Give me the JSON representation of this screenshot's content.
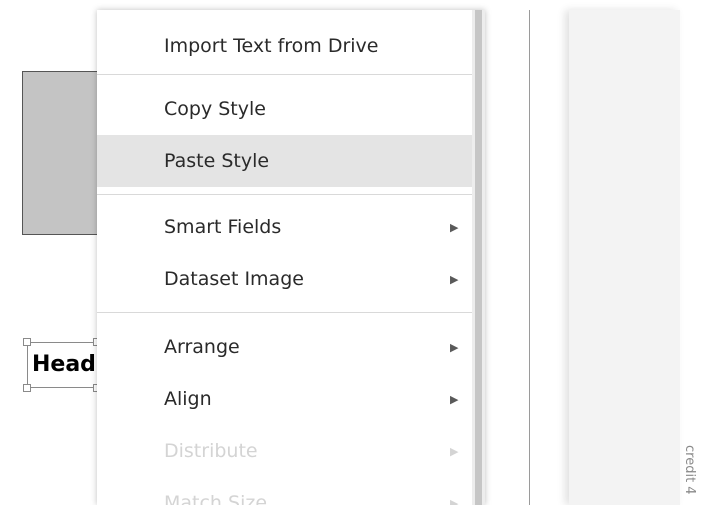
{
  "canvas": {
    "heading_text": "Heading"
  },
  "right_panel": {
    "credit_text": "credit 4"
  },
  "context_menu": {
    "items": [
      {
        "label": "Import Text from Drive",
        "has_submenu": false,
        "enabled": true,
        "highlighted": false
      },
      {
        "label": "Copy Style",
        "has_submenu": false,
        "enabled": true,
        "highlighted": false
      },
      {
        "label": "Paste Style",
        "has_submenu": false,
        "enabled": true,
        "highlighted": true
      },
      {
        "label": "Smart Fields",
        "has_submenu": true,
        "enabled": true,
        "highlighted": false
      },
      {
        "label": "Dataset Image",
        "has_submenu": true,
        "enabled": true,
        "highlighted": false
      },
      {
        "label": "Arrange",
        "has_submenu": true,
        "enabled": true,
        "highlighted": false
      },
      {
        "label": "Align",
        "has_submenu": true,
        "enabled": true,
        "highlighted": false
      },
      {
        "label": "Distribute",
        "has_submenu": true,
        "enabled": false,
        "highlighted": false
      },
      {
        "label": "Match Size",
        "has_submenu": true,
        "enabled": false,
        "highlighted": false
      }
    ],
    "submenu_arrow": "▶"
  },
  "colors": {
    "menu_text": "#2a2a2a",
    "disabled_text": "#d4d4d4",
    "highlight_bg": "#e4e4e4",
    "shape_fill": "#c4c4c4"
  }
}
